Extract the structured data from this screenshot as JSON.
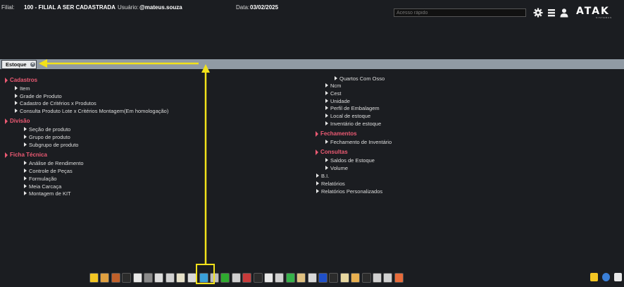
{
  "topbar": {
    "filial_label": "Filial:",
    "filial_value": "100 - FILIAL A SER CADASTRADA",
    "usuario_label": "Usuário:",
    "usuario_value": "@mateus.souza",
    "data_label": "Data:",
    "data_value": "03/02/2025",
    "search_placeholder": "Acesso rápido",
    "logo": "ATAK",
    "logo_sub": "SISTEMAS"
  },
  "tab": {
    "label": "Estoque",
    "close": "×"
  },
  "left_menu": [
    {
      "type": "cat",
      "label": "Cadastros"
    },
    {
      "type": "item",
      "label": "Item"
    },
    {
      "type": "item",
      "label": "Grade de Produto"
    },
    {
      "type": "item",
      "label": "Cadastro de Critérios x Produtos"
    },
    {
      "type": "item",
      "label": "Consulta Produto Lote x Critérios Montagem(Em homologação)"
    },
    {
      "type": "cat",
      "label": "Divisão"
    },
    {
      "type": "item",
      "label": "Seção de produto"
    },
    {
      "type": "item",
      "label": "Grupo de produto"
    },
    {
      "type": "item",
      "label": "Subgrupo de produto"
    },
    {
      "type": "cat",
      "label": "Ficha Técnica"
    },
    {
      "type": "item",
      "label": "Análise de Rendimento"
    },
    {
      "type": "item",
      "label": "Controle de Peças"
    },
    {
      "type": "item",
      "label": "Formulação"
    },
    {
      "type": "item",
      "label": "Meia Carcaça"
    },
    {
      "type": "item",
      "label": "Montagem de KIT"
    }
  ],
  "right_menu": [
    {
      "type": "item",
      "label": "Quartos Com Osso"
    },
    {
      "type": "item",
      "label": "Ncm"
    },
    {
      "type": "item",
      "label": "Cest"
    },
    {
      "type": "item",
      "label": "Unidade"
    },
    {
      "type": "item",
      "label": "Perfil de Embalagem"
    },
    {
      "type": "item",
      "label": "Local de estoque"
    },
    {
      "type": "item",
      "label": "Inventário de estoque"
    },
    {
      "type": "cat",
      "label": "Fechamentos"
    },
    {
      "type": "item",
      "label": "Fechamento de Inventário"
    },
    {
      "type": "cat",
      "label": "Consultas"
    },
    {
      "type": "item",
      "label": "Saldos de Estoque"
    },
    {
      "type": "item",
      "label": "Volume"
    },
    {
      "type": "item",
      "label": "B.I."
    },
    {
      "type": "item",
      "label": "Relatórios"
    },
    {
      "type": "item",
      "label": "Relatórios Personalizados"
    }
  ],
  "toolbar_icons": [
    {
      "name": "star-icon",
      "color": "#f3c623"
    },
    {
      "name": "users-icon",
      "color": "#e0a040"
    },
    {
      "name": "box-icon",
      "color": "#c0602a"
    },
    {
      "name": "dark-square-icon",
      "color": "#2b2b2b"
    },
    {
      "name": "document-icon",
      "color": "#e8e8e8"
    },
    {
      "name": "trash-icon",
      "color": "#8a8a8a"
    },
    {
      "name": "eject-icon",
      "color": "#dcdcdc"
    },
    {
      "name": "eraser-icon",
      "color": "#d0d0d0"
    },
    {
      "name": "scroll-icon",
      "color": "#e6e0c8"
    },
    {
      "name": "scale-icon",
      "color": "#d8d8d8"
    },
    {
      "name": "globe-icon",
      "color": "#3aa0d8"
    },
    {
      "name": "cylinder-icon",
      "color": "#bdbdbd"
    },
    {
      "name": "dollar-icon",
      "color": "#2faa2f"
    },
    {
      "name": "printer-icon",
      "color": "#cfcfcf"
    },
    {
      "name": "calendar-icon",
      "color": "#c83a3a"
    },
    {
      "name": "barcode-icon",
      "color": "#2b2b2b"
    },
    {
      "name": "bottle-icon",
      "color": "#e8e8e8"
    },
    {
      "name": "truck-icon",
      "color": "#d0d0d0"
    },
    {
      "name": "refresh-icon",
      "color": "#36b24a"
    },
    {
      "name": "tag-icon",
      "color": "#e0c080"
    },
    {
      "name": "note-icon",
      "color": "#d8d8d8"
    },
    {
      "name": "blue-square-icon",
      "color": "#1f4fc8"
    },
    {
      "name": "grid-icon",
      "color": "#2b2b2b"
    },
    {
      "name": "folder-icon",
      "color": "#e8d8a0"
    },
    {
      "name": "chart-icon",
      "color": "#e8b050"
    },
    {
      "name": "qr-icon",
      "color": "#2b2b2b"
    },
    {
      "name": "network-icon",
      "color": "#d0d0d0"
    },
    {
      "name": "headset-icon",
      "color": "#d0d0d0"
    },
    {
      "name": "circles-icon",
      "color": "#e86b3a"
    }
  ],
  "toolbar_right_icons": [
    {
      "name": "favorite-star-icon",
      "color": "#f3c623"
    },
    {
      "name": "help-icon",
      "color": "#3a7fd8"
    },
    {
      "name": "monitor-icon",
      "color": "#e8e8e8"
    }
  ],
  "colors": {
    "background": "#1b1d21",
    "category": "#ec5a73",
    "annotation": "#f2e11a",
    "tabstrip": "#909aa4"
  }
}
